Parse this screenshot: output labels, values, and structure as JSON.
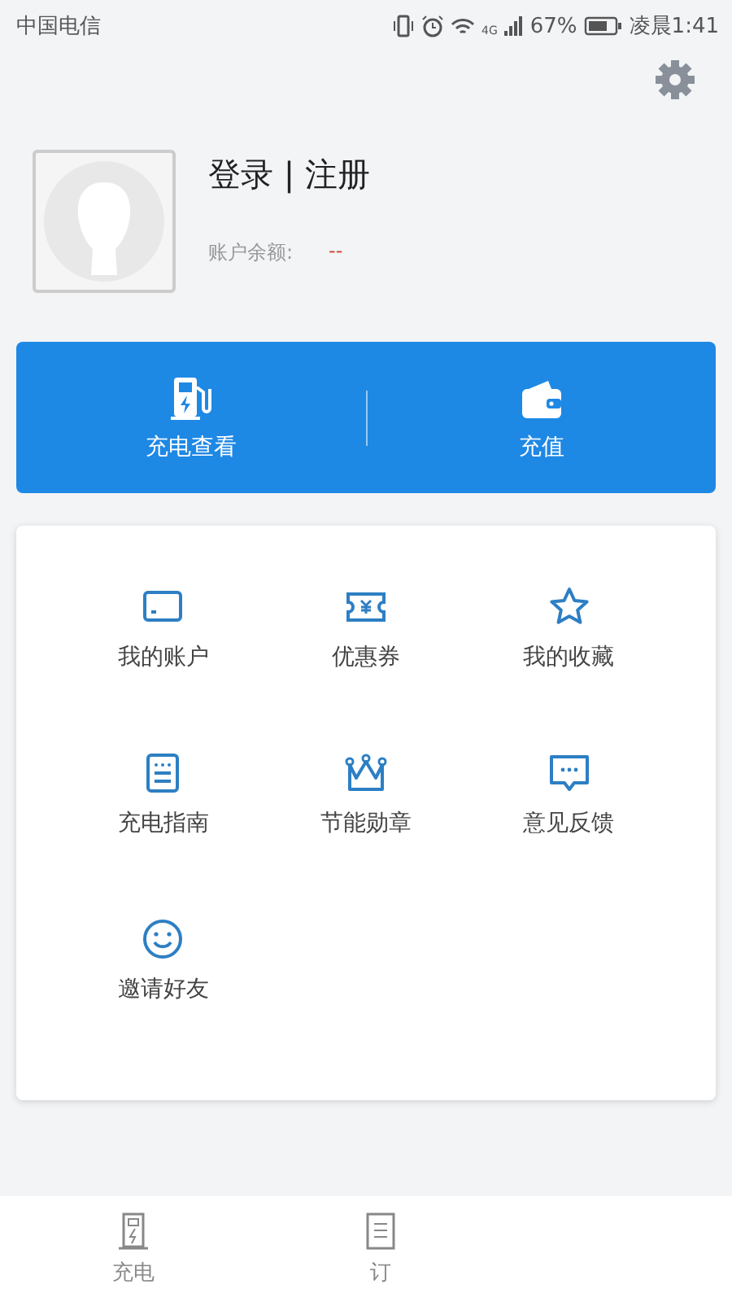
{
  "status_bar": {
    "carrier": "中国电信",
    "network": "4G",
    "battery": "67%",
    "time": "凌晨1:41"
  },
  "profile": {
    "title": "登录 | 注册",
    "balance_label": "账户余额:",
    "balance_value": "--"
  },
  "actions": [
    {
      "label": "充电查看"
    },
    {
      "label": "充值"
    }
  ],
  "menu": [
    {
      "label": "我的账户"
    },
    {
      "label": "优惠券"
    },
    {
      "label": "我的收藏"
    },
    {
      "label": "充电指南"
    },
    {
      "label": "节能勋章"
    },
    {
      "label": "意见反馈"
    },
    {
      "label": "邀请好友"
    }
  ],
  "bottom_nav": [
    {
      "label": "充电"
    },
    {
      "label": "订"
    }
  ]
}
